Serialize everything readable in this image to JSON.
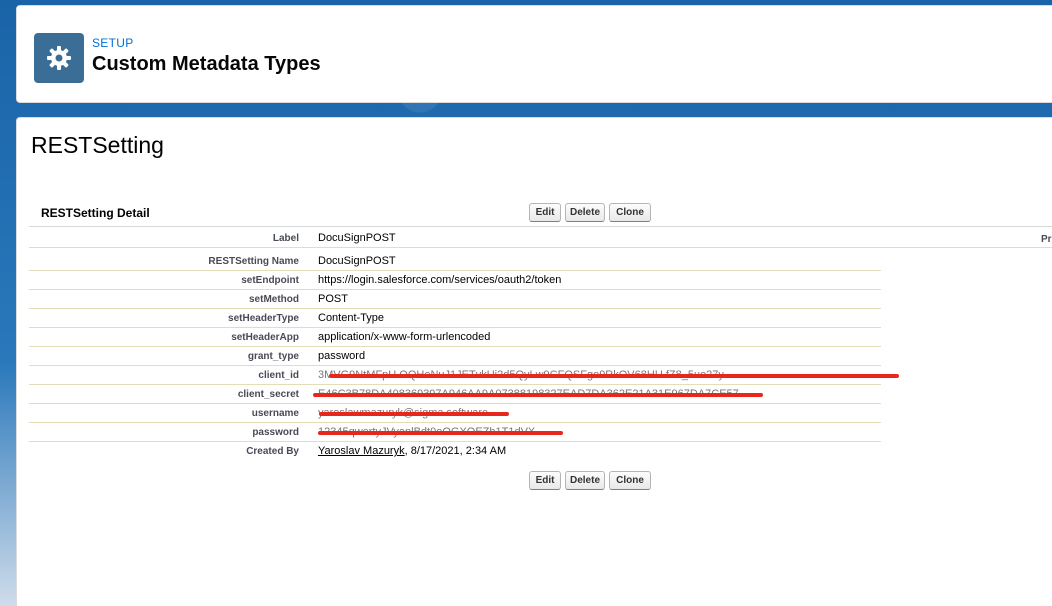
{
  "header": {
    "setup_label": "SETUP",
    "title": "Custom Metadata Types",
    "icon": "gear-icon"
  },
  "record": {
    "title": "RESTSetting",
    "detail_title": "RESTSetting Detail",
    "right_label_partial": "Pr"
  },
  "buttons": {
    "edit": "Edit",
    "delete": "Delete",
    "clone": "Clone"
  },
  "fields": [
    {
      "label": "Label",
      "value": "DocuSignPOST"
    },
    {
      "label": "RESTSetting Name",
      "value": "DocuSignPOST"
    },
    {
      "label": "setEndpoint",
      "value": "https://login.salesforce.com/services/oauth2/token"
    },
    {
      "label": "setMethod",
      "value": "POST"
    },
    {
      "label": "setHeaderType",
      "value": "Content-Type"
    },
    {
      "label": "setHeaderApp",
      "value": "application/x-www-form-urlencoded"
    },
    {
      "label": "grant_type",
      "value": "password"
    },
    {
      "label": "client_id",
      "value": "",
      "redacted": true
    },
    {
      "label": "client_secret",
      "value": "",
      "redacted": true
    },
    {
      "label": "username",
      "value": "",
      "redacted": true
    },
    {
      "label": "password",
      "value": "",
      "redacted": true
    },
    {
      "label": "Created By",
      "value_link": "Yaroslav Mazuryk",
      "value_suffix": ", 8/17/2021, 2:34 AM"
    }
  ],
  "colors": {
    "accent": "#0070d2",
    "icon_bg": "#3a6e96",
    "redaction": "#e8261c"
  }
}
